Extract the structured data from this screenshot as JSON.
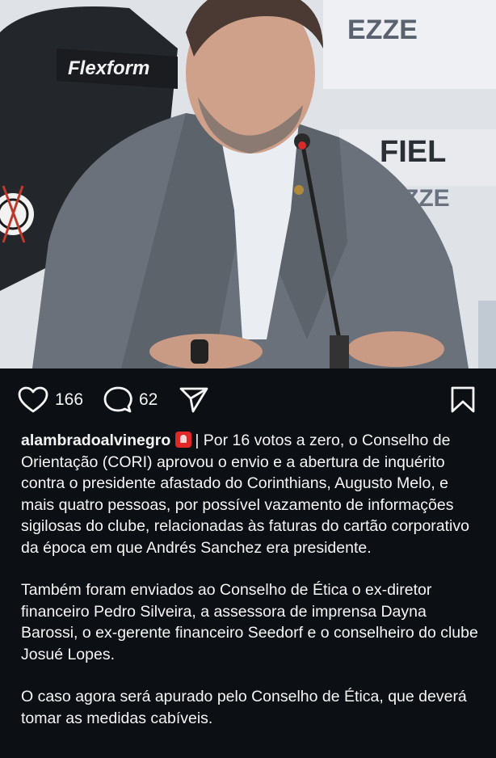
{
  "photo": {
    "alt": "Man in grey suit speaking into a microphone at a press conference",
    "backdrop_brand_1": "Flexform",
    "backdrop_brand_2": "EZZE",
    "backdrop_brand_3": "FIEL"
  },
  "actions": {
    "likes": "166",
    "comments": "62",
    "like_icon": "heart-icon",
    "comment_icon": "comment-bubble-icon",
    "share_icon": "paper-plane-icon",
    "save_icon": "bookmark-icon"
  },
  "caption": {
    "username": "alambradoalvinegro",
    "emoji": "siren-emoji",
    "para1": "| Por 16 votos a zero, o Conselho de Orientação (CORI) aprovou o envio e a abertura de inquérito contra o presidente afastado do Corinthians, Augusto Melo, e mais quatro pessoas, por possível vazamento de informações sigilosas do clube, relacionadas às faturas do cartão corporativo da época em que Andrés Sanchez era presidente.",
    "para2": "Também foram enviados ao Conselho de Ética o ex-diretor financeiro Pedro Silveira, a assessora de imprensa Dayna Barossi, o ex-gerente financeiro Seedorf e o conselheiro do clube Josué Lopes.",
    "para3": "O caso agora será apurado pelo Conselho de Ética, que deverá tomar as medidas cabíveis."
  },
  "colors": {
    "background": "#0c1014",
    "text": "#f5f5f5",
    "emoji_red": "#e02828"
  }
}
